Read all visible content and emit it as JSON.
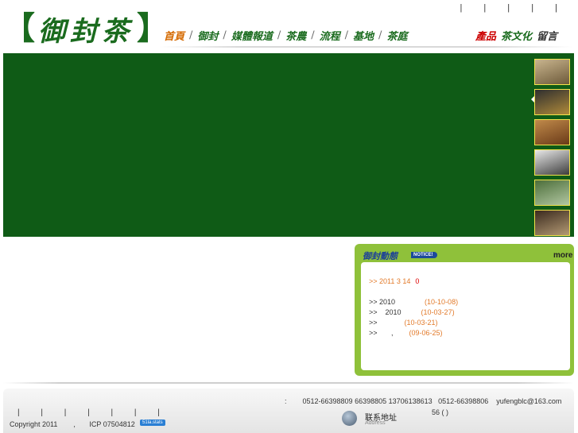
{
  "header": {
    "logo_bracket_left": "【",
    "logo_text": "御封茶",
    "logo_bracket_right": "】",
    "top_links": "| | | | |",
    "nav": [
      {
        "label": "首頁",
        "active": true
      },
      {
        "label": "御封"
      },
      {
        "label": "媒體報道"
      },
      {
        "label": "茶農"
      },
      {
        "label": "流程"
      },
      {
        "label": "基地"
      },
      {
        "label": "茶庭"
      }
    ],
    "nav_right": [
      {
        "label": "產品",
        "tone": "red"
      },
      {
        "label": "茶文化",
        "tone": "green"
      },
      {
        "label": "留言",
        "tone": "gray"
      }
    ]
  },
  "thumbnails": [
    {
      "name": "thumb-1",
      "colors": [
        "#c9b58e",
        "#6d5a3a"
      ]
    },
    {
      "name": "thumb-2",
      "colors": [
        "#2f2f2f",
        "#b08a3a"
      ]
    },
    {
      "name": "thumb-3",
      "colors": [
        "#c08a4a",
        "#6a3a18"
      ]
    },
    {
      "name": "thumb-4",
      "colors": [
        "#e8e8e8",
        "#3c3c3c"
      ]
    },
    {
      "name": "thumb-5",
      "colors": [
        "#4c6e3a",
        "#b2c7a2"
      ]
    },
    {
      "name": "thumb-6",
      "colors": [
        "#3a2a1e",
        "#b49a74"
      ]
    }
  ],
  "news": {
    "title": "御封動態",
    "badge": "NOTICE!",
    "more": "more",
    "first": {
      "text": ">> 2011 3 14",
      "num": "0"
    },
    "items": [
      {
        "text": ">> 2010",
        "date": "(10-10-08)"
      },
      {
        "text": ">>    2010",
        "date": "(10-03-27)"
      },
      {
        "text": ">>",
        "date": "(10-03-21)"
      },
      {
        "text": ">>       ,",
        "date": "(09-06-25)"
      }
    ]
  },
  "footer": {
    "contact": ":        0512-66398809 66398805 13706138613   0512-66398806    yufengblc@163.com",
    "links": "| | | | | | |",
    "copyright": "Copyright 2011        ,       ICP 07504812",
    "stat_badge": "51la.stats",
    "address_label": "联系地址",
    "address_sub": "Address",
    "room": "56 (    )"
  },
  "colors": {
    "banner": "#0f5b16",
    "news_frame": "#8fc13a",
    "nav_green": "#1a6b1e",
    "date_orange": "#e27a2a"
  }
}
